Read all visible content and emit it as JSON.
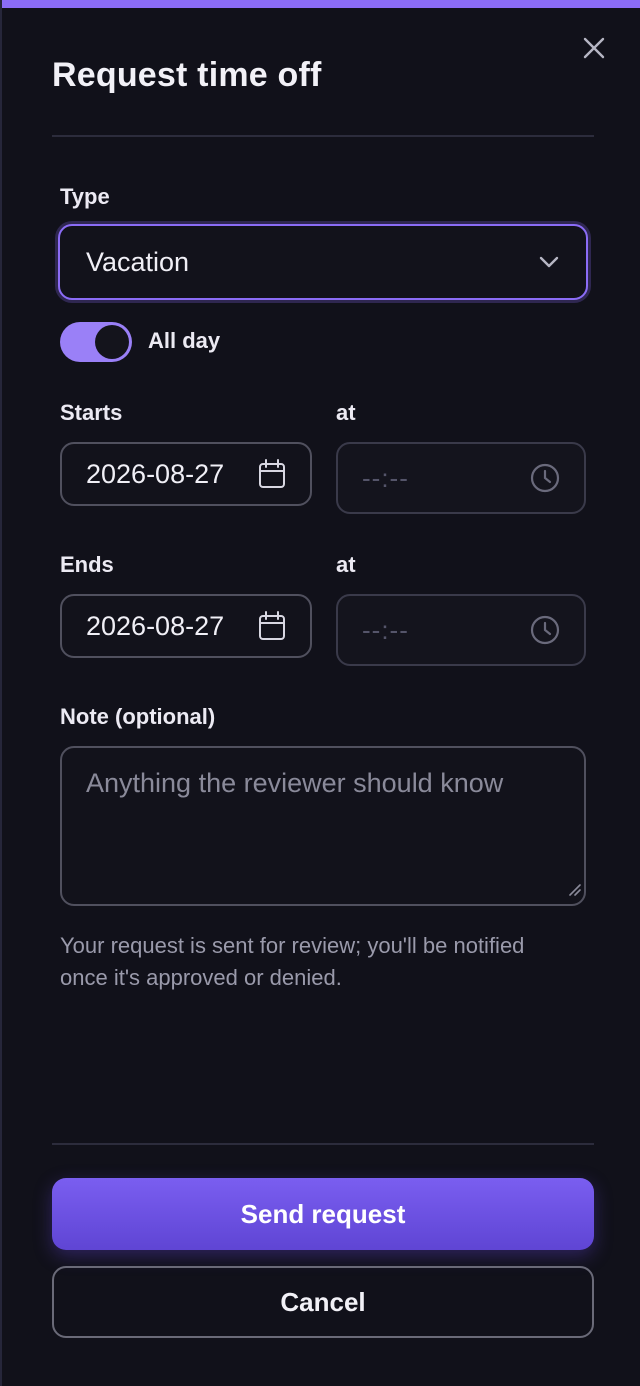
{
  "dialog": {
    "title": "Request time off",
    "accent_color": "#8b6cf6",
    "close_icon": "close-icon"
  },
  "type": {
    "label": "Type",
    "value": "Vacation",
    "icon": "chevron-down-icon"
  },
  "all_day": {
    "label": "All day",
    "checked": true
  },
  "starts": {
    "label": "Starts",
    "date": "2026-08-27",
    "date_icon": "calendar-icon",
    "time_label": "at",
    "time_placeholder": "--:--",
    "time_icon": "clock-icon"
  },
  "ends": {
    "label": "Ends",
    "date": "2026-08-27",
    "date_icon": "calendar-icon",
    "time_label": "at",
    "time_placeholder": "--:--",
    "time_icon": "clock-icon"
  },
  "note": {
    "label": "Note (optional)",
    "placeholder": "Anything the reviewer should know"
  },
  "helper_text": "Your request is sent for review; you'll be notified once it's approved or denied.",
  "actions": {
    "primary": "Send request",
    "secondary": "Cancel"
  }
}
